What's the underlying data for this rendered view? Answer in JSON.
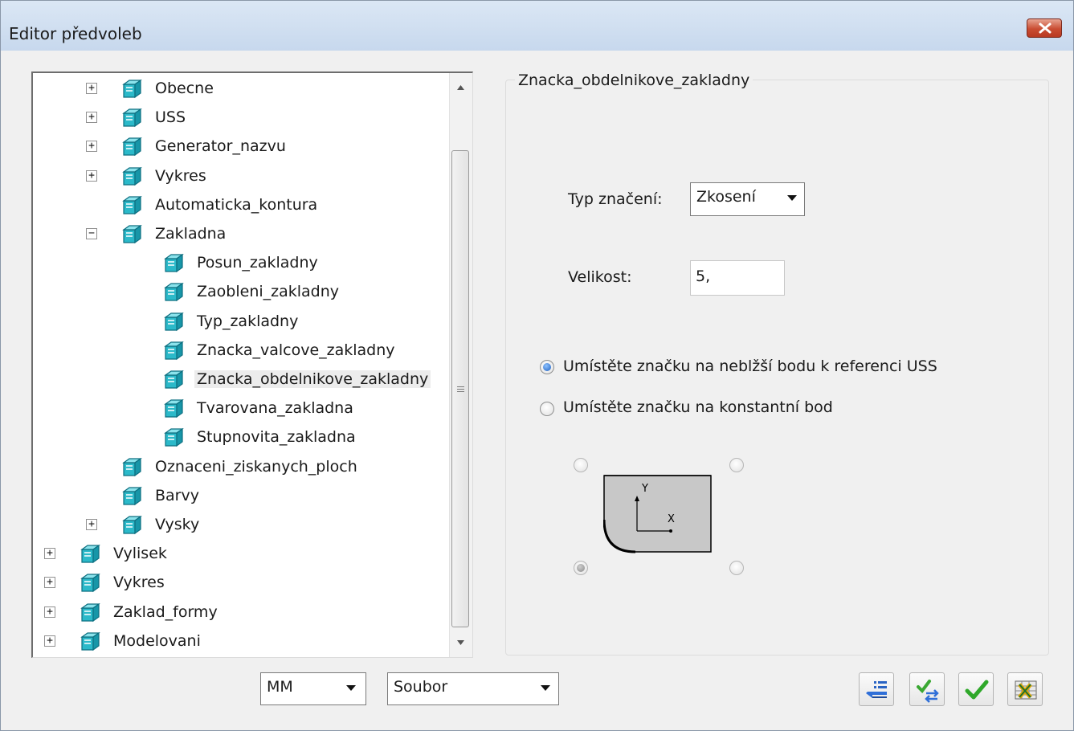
{
  "window": {
    "title": "Editor předvoleb"
  },
  "tree": {
    "items": [
      {
        "label": "Obecne",
        "level": 1,
        "expander": "+"
      },
      {
        "label": "USS",
        "level": 1,
        "expander": "+"
      },
      {
        "label": "Generator_nazvu",
        "level": 1,
        "expander": "+"
      },
      {
        "label": "Vykres",
        "level": 1,
        "expander": "+"
      },
      {
        "label": "Automaticka_kontura",
        "level": 1,
        "expander": ""
      },
      {
        "label": "Zakladna",
        "level": 1,
        "expander": "−"
      },
      {
        "label": "Posun_zakladny",
        "level": 2,
        "expander": ""
      },
      {
        "label": "Zaobleni_zakladny",
        "level": 2,
        "expander": ""
      },
      {
        "label": "Typ_zakladny",
        "level": 2,
        "expander": ""
      },
      {
        "label": "Znacka_valcove_zakladny",
        "level": 2,
        "expander": ""
      },
      {
        "label": "Znacka_obdelnikove_zakladny",
        "level": 2,
        "expander": "",
        "selected": true
      },
      {
        "label": "Tvarovana_zakladna",
        "level": 2,
        "expander": ""
      },
      {
        "label": "Stupnovita_zakladna",
        "level": 2,
        "expander": ""
      },
      {
        "label": "Oznaceni_ziskanych_ploch",
        "level": 1,
        "expander": ""
      },
      {
        "label": "Barvy",
        "level": 1,
        "expander": ""
      },
      {
        "label": "Vysky",
        "level": 1,
        "expander": "+"
      },
      {
        "label": "Vylisek",
        "level": 0,
        "expander": "+"
      },
      {
        "label": "Vykres",
        "level": 0,
        "expander": "+"
      },
      {
        "label": "Zaklad_formy",
        "level": 0,
        "expander": "+"
      },
      {
        "label": "Modelovani",
        "level": 0,
        "expander": "+"
      }
    ]
  },
  "panel": {
    "title": "Znacka_obdelnikove_zakladny",
    "typ_label": "Typ značení:",
    "typ_value": "Zkosení",
    "velikost_label": "Velikost:",
    "velikost_value": "5,",
    "option_nearest": "Umístěte značku na neblžší bodu k referenci USS",
    "option_constant": "Umístěte značku na konstantní bod",
    "selected_option": "nearest",
    "corner_selected": "bottom-left",
    "axis_y": "Y",
    "axis_x": "X"
  },
  "footer": {
    "units_value": "MM",
    "source_value": "Soubor"
  },
  "icons": {
    "tree_node": "folder-cube-icon",
    "toolbar": [
      "import-list-icon",
      "transfer-icon",
      "ok-check-icon",
      "excel-export-icon"
    ]
  }
}
